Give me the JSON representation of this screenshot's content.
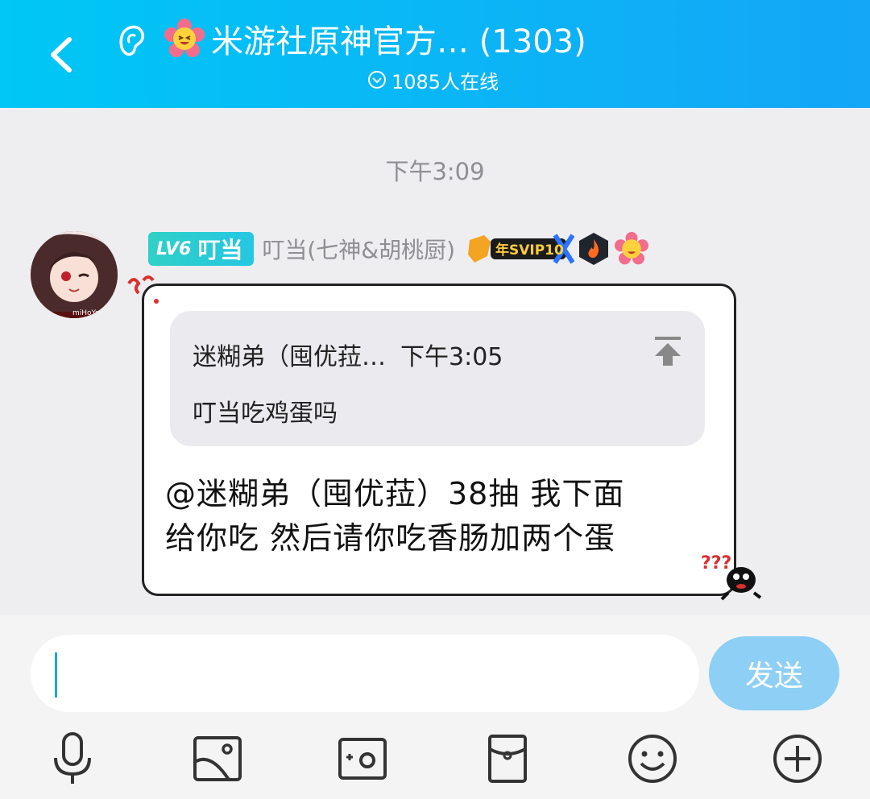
{
  "header": {
    "title": "米游社原神官方… (1303)",
    "online": "1085人在线",
    "title_emoji": "flower-emoji"
  },
  "chat": {
    "timestamp": "下午3:09",
    "message": {
      "level": "LV6",
      "level_name": "叮当",
      "nickname": "叮当(七神&胡桃厨)",
      "svip_badge": "年SVIP10",
      "quote": {
        "author": "迷糊弟（囤优菈…",
        "time": "下午3:05",
        "text": "叮当吃鸡蛋吗"
      },
      "text_line1": "@迷糊弟（囤优菈）38抽 我下面",
      "text_line2": "给你吃 然后请你吃香肠加两个蛋"
    }
  },
  "input": {
    "send_label": "发送",
    "placeholder": ""
  },
  "toolbar": [
    "microphone-icon",
    "image-icon",
    "camera-icon",
    "red-packet-icon",
    "emoji-icon",
    "plus-icon"
  ],
  "colors": {
    "header_start": "#00c7f5",
    "header_end": "#14a6f7",
    "send_button": "#8dcff5",
    "caret": "#1fa3f0"
  }
}
